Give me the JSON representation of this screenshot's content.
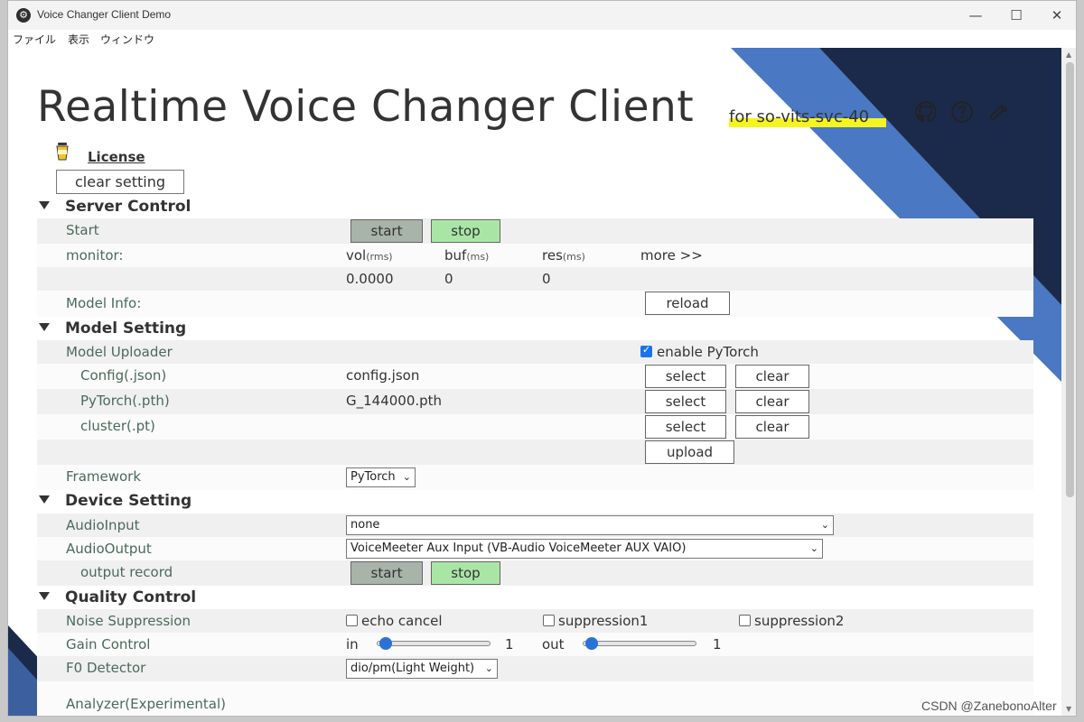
{
  "window": {
    "title": "Voice Changer Client Demo",
    "minimize": "—",
    "maximize": "☐",
    "close": "✕"
  },
  "menu": [
    "ファイル",
    "表示",
    "ウィンドウ"
  ],
  "header": {
    "title": "Realtime Voice Changer Client",
    "subtitle": "for so-vits-svc-40",
    "license": "License",
    "clear_setting": "clear setting"
  },
  "server_control": {
    "heading": "Server Control",
    "start_label": "Start",
    "start_btn": "start",
    "stop_btn": "stop",
    "monitor_label": "monitor:",
    "vol": "vol",
    "vol_unit": "(rms)",
    "buf": "buf",
    "buf_unit": "(ms)",
    "res": "res",
    "res_unit": "(ms)",
    "more": "more >>",
    "vol_value": "0.0000",
    "buf_value": "0",
    "res_value": "0",
    "model_info_label": "Model Info:",
    "reload_btn": "reload"
  },
  "model_setting": {
    "heading": "Model Setting",
    "uploader_label": "Model Uploader",
    "enable_pytorch": "enable PyTorch",
    "enable_pytorch_checked": true,
    "config_label": "Config(.json)",
    "config_value": "config.json",
    "pytorch_label": "PyTorch(.pth)",
    "pytorch_value": "G_144000.pth",
    "cluster_label": "cluster(.pt)",
    "select_btn": "select",
    "clear_btn": "clear",
    "upload_btn": "upload",
    "framework_label": "Framework",
    "framework_value": "PyTorch"
  },
  "device_setting": {
    "heading": "Device Setting",
    "audio_input_label": "AudioInput",
    "audio_input_value": "none",
    "audio_output_label": "AudioOutput",
    "audio_output_value": "VoiceMeeter Aux Input (VB-Audio VoiceMeeter AUX VAIO)",
    "output_record_label": "output record",
    "start_btn": "start",
    "stop_btn": "stop"
  },
  "quality_control": {
    "heading": "Quality Control",
    "noise_label": "Noise Suppression",
    "echo_cancel": "echo cancel",
    "suppression1": "suppression1",
    "suppression2": "suppression2",
    "gain_label": "Gain Control",
    "in_label": "in",
    "in_value": "1",
    "out_label": "out",
    "out_value": "1",
    "f0_label": "F0 Detector",
    "f0_value": "dio/pm(Light Weight)",
    "analyzer_label": "Analyzer(Experimental)"
  },
  "watermark": "CSDN @ZanebonoAlter",
  "colors": {
    "accent_blue": "#4a78c2",
    "dark_navy": "#1b2a4a",
    "start_btn": "#a8b3a9",
    "stop_btn": "#a9e6a6",
    "highlight": "#f5f51d"
  }
}
